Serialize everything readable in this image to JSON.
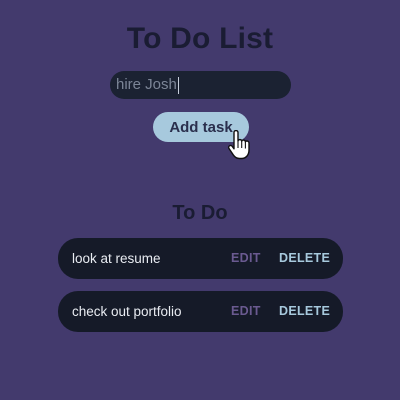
{
  "app": {
    "title": "To Do List"
  },
  "form": {
    "input_value": "hire Josh",
    "add_label": "Add task"
  },
  "list": {
    "heading": "To Do",
    "items": [
      {
        "text": "look at resume",
        "edit_label": "EDIT",
        "delete_label": "DELETE"
      },
      {
        "text": "check out portfolio",
        "edit_label": "EDIT",
        "delete_label": "DELETE"
      }
    ]
  },
  "colors": {
    "background": "#433a6d",
    "title": "#1a1c33",
    "row_background": "#151a28",
    "accent": "#a7c9dd",
    "edit": "#6a5a90"
  },
  "icons": {
    "pointer": "hand-pointer-icon"
  }
}
